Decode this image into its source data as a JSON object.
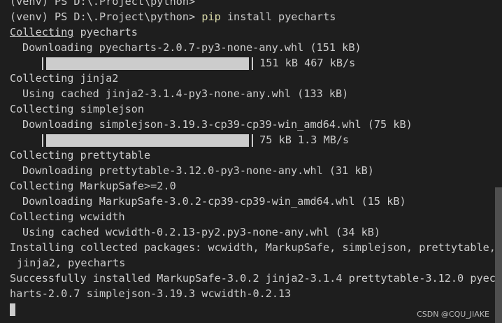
{
  "terminal": {
    "prev_prompt": "(venv) PS D:\\.Project\\python>",
    "prompt": "(venv) PS D:\\.Project\\python>",
    "command_pip": "pip",
    "command_args": " install pyecharts",
    "collecting_pyecharts_word": "Collecting",
    "collecting_pyecharts_pkg": " pyecharts",
    "downloading_pyecharts": "Downloading pyecharts-2.0.7-py3-none-any.whl (151 kB)",
    "progress1_text": "151 kB 467 kB/s",
    "progress1_fraction": 1.0,
    "collecting_jinja2": "Collecting jinja2",
    "cached_jinja2": "Using cached jinja2-3.1.4-py3-none-any.whl (133 kB)",
    "collecting_simplejson": "Collecting simplejson",
    "downloading_simplejson": "Downloading simplejson-3.19.3-cp39-cp39-win_amd64.whl (75 kB)",
    "progress2_text": "75 kB 1.3 MB/s",
    "progress2_fraction": 1.0,
    "collecting_prettytable": "Collecting prettytable",
    "downloading_prettytable": "Downloading prettytable-3.12.0-py3-none-any.whl (31 kB)",
    "collecting_markupsafe": "Collecting MarkupSafe>=2.0",
    "downloading_markupsafe": "Downloading MarkupSafe-3.0.2-cp39-cp39-win_amd64.whl (15 kB)",
    "collecting_wcwidth": "Collecting wcwidth",
    "cached_wcwidth": "Using cached wcwidth-0.2.13-py2.py3-none-any.whl (34 kB)",
    "installing_line1": "Installing collected packages: wcwidth, MarkupSafe, simplejson, prettytable,",
    "installing_line2": "jinja2, pyecharts",
    "success_line1": "Successfully installed MarkupSafe-3.0.2 jinja2-3.1.4 prettytable-3.12.0 pyec",
    "success_line2": "harts-2.0.7 simplejson-3.19.3 wcwidth-0.2.13"
  },
  "watermark": "CSDN @CQU_JIAKE",
  "colors": {
    "background": "#1e1e1e",
    "text": "#cccccc",
    "command": "#dcdcaa",
    "scroll_thumb": "#4f4f4f"
  }
}
